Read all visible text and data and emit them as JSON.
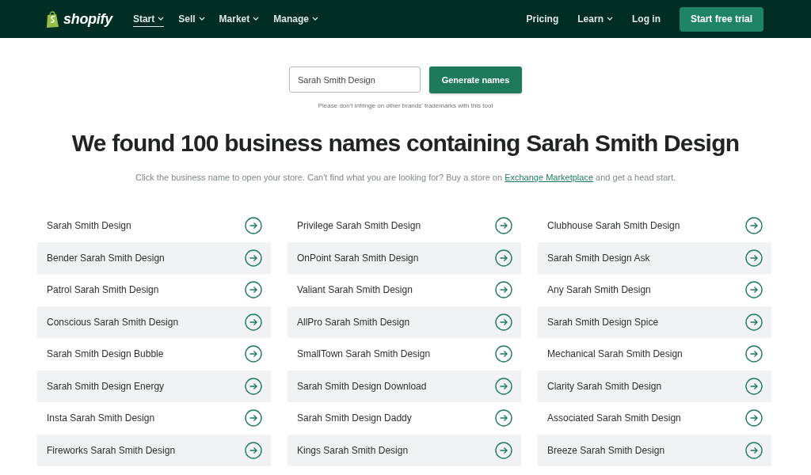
{
  "nav": {
    "logo": "shopify",
    "items": [
      {
        "label": "Start",
        "selected": true,
        "dropdown": true
      },
      {
        "label": "Sell",
        "selected": false,
        "dropdown": true
      },
      {
        "label": "Market",
        "selected": false,
        "dropdown": true
      },
      {
        "label": "Manage",
        "selected": false,
        "dropdown": true
      }
    ],
    "right_items": [
      {
        "label": "Pricing",
        "dropdown": false
      },
      {
        "label": "Learn",
        "dropdown": true
      },
      {
        "label": "Log in",
        "dropdown": false
      }
    ],
    "cta": "Start free trial"
  },
  "search": {
    "value": "Sarah Smith Design",
    "button": "Generate names",
    "note": "Please don't infringe on other brands' trademarks with this tool"
  },
  "heading": "We found 100 business names containing Sarah Smith Design",
  "subtitle": {
    "before": "Click the business name to open your store. Can't find what you are looking for? Buy a store on ",
    "link": "Exchange Marketplace",
    "after": " and get a head start."
  },
  "columns": [
    [
      "Sarah Smith Design",
      "Bender Sarah Smith Design",
      "Patrol Sarah Smith Design",
      "Conscious Sarah Smith Design",
      "Sarah Smith Design Bubble",
      "Sarah Smith Design Energy",
      "Insta Sarah Smith Design",
      "Fireworks Sarah Smith Design"
    ],
    [
      "Privilege Sarah Smith Design",
      "OnPoint Sarah Smith Design",
      "Valiant Sarah Smith Design",
      "AllPro Sarah Smith Design",
      "SmallTown Sarah Smith Design",
      "Sarah Smith Design Download",
      "Sarah Smith Design Daddy",
      "Kings Sarah Smith Design"
    ],
    [
      "Clubhouse Sarah Smith Design",
      "Sarah Smith Design Ask",
      "Any Sarah Smith Design",
      "Sarah Smith Design Spice",
      "Mechanical Sarah Smith Design",
      "Clarity Sarah Smith Design",
      "Associated Sarah Smith Design",
      "Breeze Sarah Smith Design"
    ]
  ]
}
